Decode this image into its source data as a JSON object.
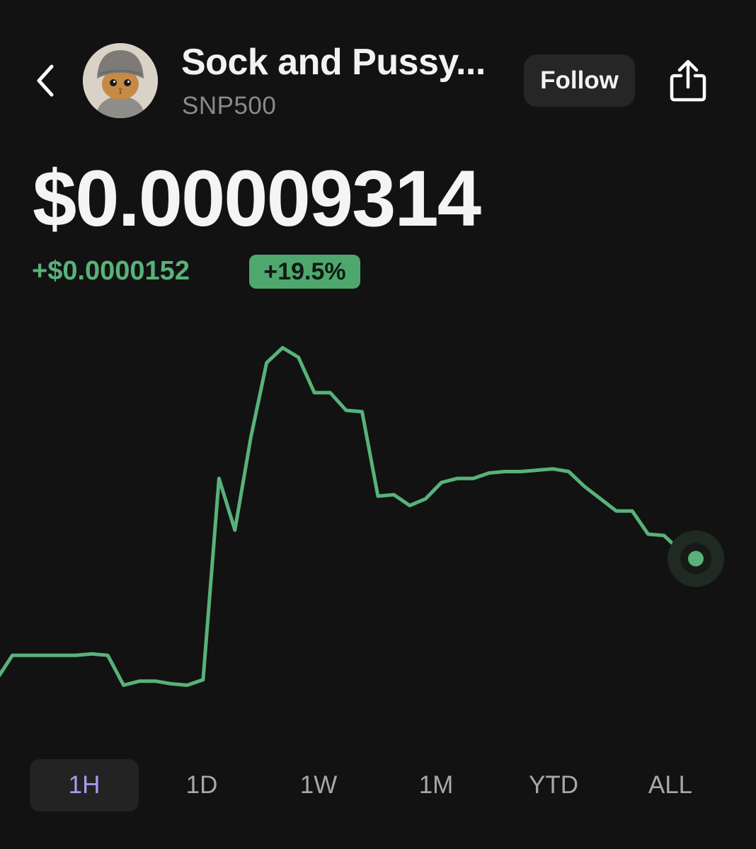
{
  "header": {
    "token_name": "Sock and Pussy...",
    "token_symbol": "SNP500",
    "follow_label": "Follow",
    "icons": [
      "chevron-left-icon",
      "cat-avatar",
      "share-icon"
    ]
  },
  "price": {
    "current": "$0.00009314",
    "change_amount": "+$0.0000152",
    "change_percent": "+19.5%"
  },
  "colors": {
    "background": "#121212",
    "positive_green": "#58b27a",
    "badge_green": "#4ea86e",
    "active_tab_text": "#a99cf0",
    "active_tab_bg": "#232323"
  },
  "chart_data": {
    "type": "line",
    "title": "",
    "xlabel": "",
    "ylabel": "",
    "grid": false,
    "series": [
      {
        "values": [
          7.1,
          7.28,
          7.28,
          7.28,
          7.28,
          7.28,
          7.29,
          7.28,
          7.06,
          7.09,
          7.09,
          7.07,
          7.06,
          7.1,
          8.58,
          8.2,
          8.88,
          9.43,
          9.54,
          9.47,
          9.21,
          9.21,
          9.08,
          9.07,
          8.45,
          8.46,
          8.38,
          8.43,
          8.55,
          8.58,
          8.58,
          8.62,
          8.63,
          8.63,
          8.64,
          8.65,
          8.63,
          8.52,
          8.43,
          8.34,
          8.34,
          8.17,
          8.16,
          8.05,
          7.99
        ]
      }
    ]
  },
  "time_ranges": {
    "active": "1H",
    "items": [
      "1H",
      "1D",
      "1W",
      "1M",
      "YTD",
      "ALL"
    ]
  }
}
